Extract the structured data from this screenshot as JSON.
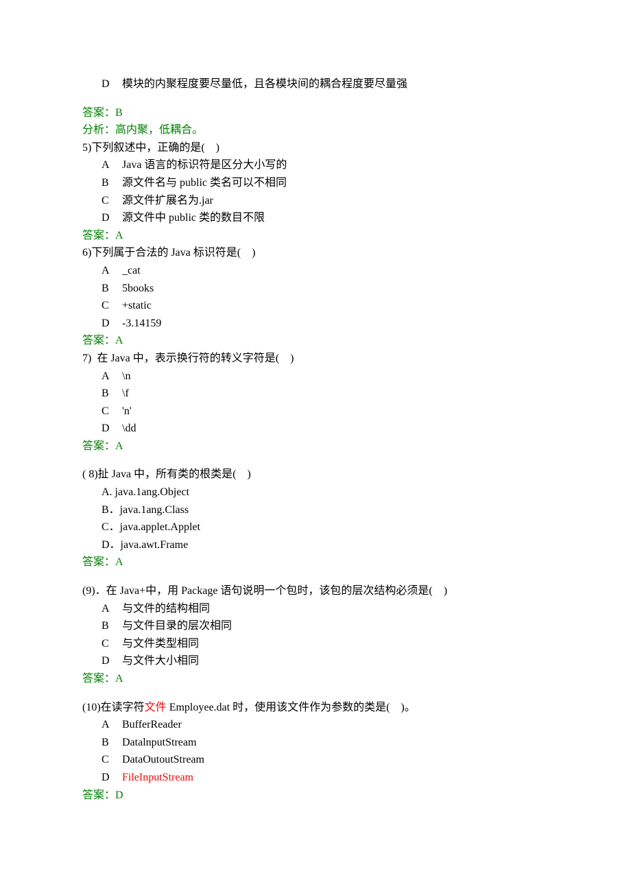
{
  "q4_option_D_letter": "D",
  "q4_option_D_text": "模块的内聚程度要尽量低，且各模块间的耦合程度要尽量强",
  "q4_answer": "答案：B",
  "q4_analysis": "分析：高内聚，低耦合。",
  "q5_stem": "5)下列叙述中，正确的是(    )",
  "q5_A_letter": "A",
  "q5_A_text": "Java 语言的标识符是区分大小写的",
  "q5_B_letter": "B",
  "q5_B_text": "源文件名与 public 类名可以不相同",
  "q5_C_letter": "C",
  "q5_C_text": "源文件扩展名为.jar",
  "q5_D_letter": "D",
  "q5_D_text": "源文件中 public 类的数目不限",
  "q5_answer": "答案：A",
  "q6_stem": "6)下列属于合法的 Java 标识符是(    )",
  "q6_A_letter": "A",
  "q6_A_text": "_cat",
  "q6_B_letter": "B",
  "q6_B_text": "5books",
  "q6_C_letter": "C",
  "q6_C_text": "+static",
  "q6_D_letter": "D",
  "q6_D_text": "-3.14159",
  "q6_answer": "答案：A",
  "q7_stem": "7)  在 Java 中，表示换行符的转义字符是(    )",
  "q7_A_letter": "A",
  "q7_A_text": "\\n",
  "q7_B_letter": "B",
  "q7_B_text": "\\f",
  "q7_C_letter": "C",
  "q7_C_text": "'n'",
  "q7_D_letter": "D",
  "q7_D_text": "\\dd",
  "q7_answer": "答案：A",
  "q8_stem": "( 8)扯 Java 中，所有类的根类是(    )",
  "q8_A": "A. java.1ang.Object",
  "q8_B": "B．java.1ang.Class",
  "q8_C": "C．java.applet.Applet",
  "q8_D": "D．java.awt.Frame",
  "q8_answer": "答案：A",
  "q9_stem": "(9)．在 Java+中，用 Package 语句说明一个包时，该包的层次结构必须是(    )",
  "q9_A_letter": "A",
  "q9_A_text": "与文件的结构相同",
  "q9_B_letter": "B",
  "q9_B_text": "与文件目录的层次相同",
  "q9_C_letter": "C",
  "q9_C_text": "与文件类型相同",
  "q9_D_letter": "D",
  "q9_D_text": "与文件大小相同",
  "q9_answer": "答案：A",
  "q10_stem_pre": "(10)在读字符",
  "q10_stem_file": "文件",
  "q10_stem_post": " Employee.dat 时，使用该文件作为参数的类是(    )。",
  "q10_A_letter": "A",
  "q10_A_text": "BufferReader",
  "q10_B_letter": "B",
  "q10_B_text": "DatalnputStream",
  "q10_C_letter": "C",
  "q10_C_text": "DataOutoutStream",
  "q10_D_letter": "D",
  "q10_D_text": "FileInputStream",
  "q10_answer": "答案：D"
}
